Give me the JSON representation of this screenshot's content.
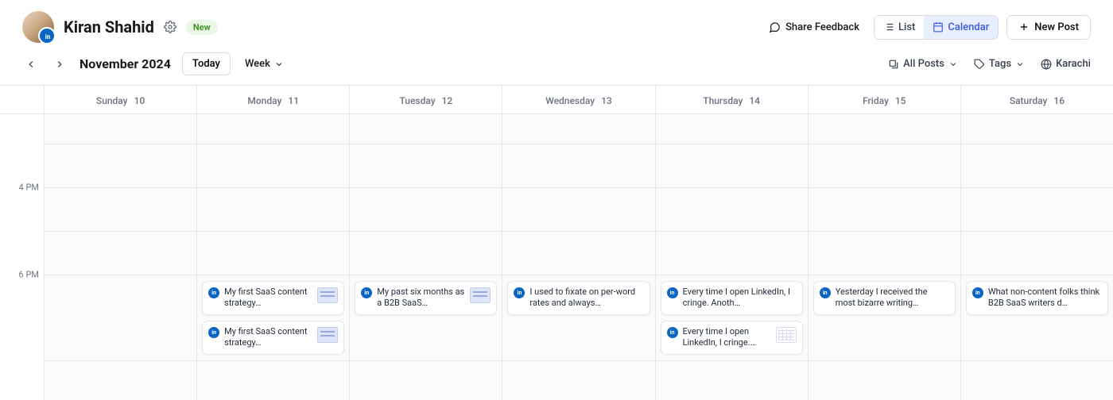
{
  "header": {
    "name": "Kiran Shahid",
    "badge": "New",
    "feedback": "Share Feedback",
    "list": "List",
    "calendar": "Calendar",
    "new_post": "New Post"
  },
  "nav": {
    "month": "November 2024",
    "today": "Today",
    "range": "Week",
    "all_posts": "All Posts",
    "tags": "Tags",
    "tz": "Karachi"
  },
  "days": [
    {
      "name": "Sunday",
      "num": "10"
    },
    {
      "name": "Monday",
      "num": "11"
    },
    {
      "name": "Tuesday",
      "num": "12"
    },
    {
      "name": "Wednesday",
      "num": "13"
    },
    {
      "name": "Thursday",
      "num": "14"
    },
    {
      "name": "Friday",
      "num": "15"
    },
    {
      "name": "Saturday",
      "num": "16"
    }
  ],
  "times": {
    "t4": "4 PM",
    "t6": "6 PM"
  },
  "posts": {
    "mon1": "My first SaaS content strategy…",
    "mon2": "My first SaaS content strategy…",
    "tue1": "My past six months as a B2B SaaS…",
    "wed1": "I used to fixate on per-word rates and always…",
    "thu1": "Every time I open LinkedIn, I cringe. Anoth…",
    "thu2": "Every time I open LinkedIn, I cringe.…",
    "fri1": "Yesterday I received the most bizarre writing…",
    "sat1": "What non-content folks think B2B SaaS writers d…"
  }
}
